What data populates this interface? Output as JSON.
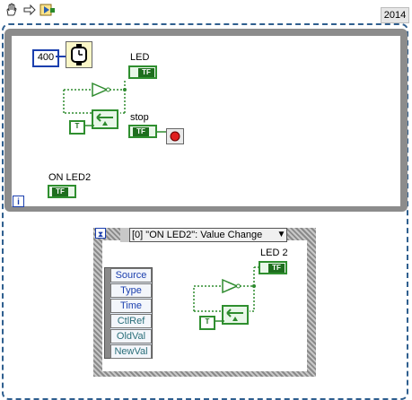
{
  "toolbar": {
    "icons": [
      "hand-icon",
      "arrow-icon",
      "run-icon"
    ],
    "version": "2014"
  },
  "while_loop": {
    "wait_value": "400",
    "wait_icon": "wait-ms-icon",
    "led_label": "LED",
    "stop_label": "stop",
    "on_led2_label": "ON LED2",
    "iteration_terminal": "i",
    "bool_terminal_text": "TF",
    "true_constant": "T"
  },
  "event_structure": {
    "case_label": "[0] \"ON LED2\": Value Change",
    "led2_label": "LED 2",
    "event_data_fields": [
      "Source",
      "Type",
      "Time",
      "CtlRef",
      "OldVal",
      "NewVal"
    ],
    "timeout_icon": "hourglass-icon"
  },
  "colors": {
    "numeric_blue": "#1b3fae",
    "boolean_green": "#2e8b2e",
    "frame_gray": "#8c8c8c",
    "stop_red": "#e02020"
  }
}
